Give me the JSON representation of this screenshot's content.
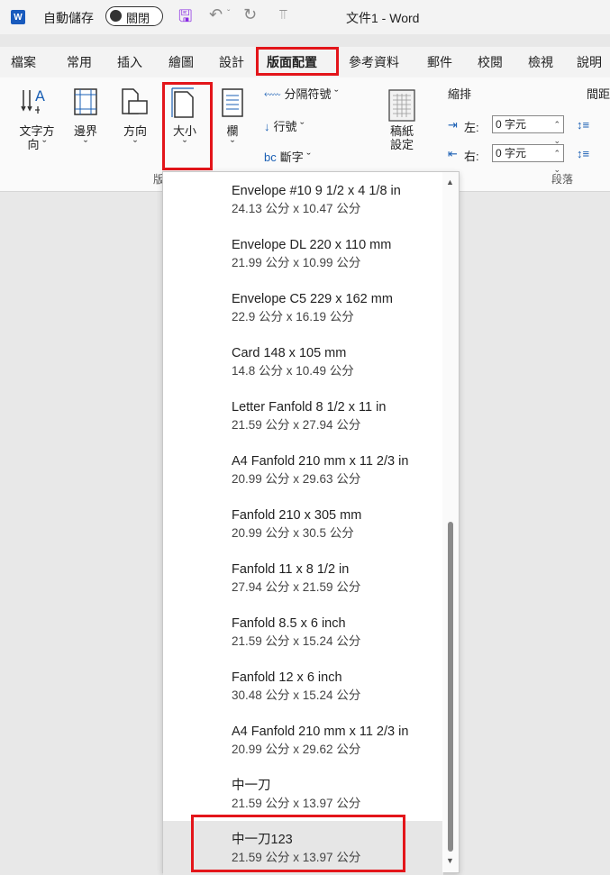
{
  "titlebar": {
    "app_icon": "W",
    "autosave_label": "自動儲存",
    "autosave_state": "關閉",
    "doc_title": "文件1 - Word",
    "icons": [
      "save-icon",
      "undo-icon",
      "redo-icon",
      "customize-qat-icon"
    ]
  },
  "tabs": [
    "檔案",
    "常用",
    "插入",
    "繪圖",
    "設計",
    "版面配置",
    "參考資料",
    "郵件",
    "校閱",
    "檢視",
    "說明"
  ],
  "active_tab": "版面配置",
  "ribbon": {
    "text_direction": {
      "line1": "文字方",
      "line2": "向 ˇ"
    },
    "margins": {
      "line1": "邊界",
      "line2": "ˇ"
    },
    "orientation": {
      "line1": "方向",
      "line2": "ˇ"
    },
    "size": {
      "line1": "大小",
      "line2": "ˇ"
    },
    "columns": {
      "line1": "欄",
      "line2": "ˇ"
    },
    "breaks": "分隔符號 ˇ",
    "line_numbers": "行號 ˇ",
    "hyphenation": "斷字 ˇ",
    "draft_settings": {
      "line1": "稿紙",
      "line2": "設定"
    },
    "indent_label": "縮排",
    "spacing_label": "間距",
    "left_label": "左:",
    "left_value": "0 字元",
    "right_label": "右:",
    "right_value": "0 字元",
    "group_page_setup": "版",
    "group_paragraph": "段落"
  },
  "size_menu": {
    "items": [
      {
        "name": "Envelope #10 9 1/2 x 4 1/8 in",
        "dims": "24.13 公分 x 10.47 公分"
      },
      {
        "name": "Envelope DL 220 x 110 mm",
        "dims": "21.99 公分 x 10.99 公分"
      },
      {
        "name": "Envelope C5 229 x 162 mm",
        "dims": "22.9 公分 x 16.19 公分"
      },
      {
        "name": "Card 148 x 105 mm",
        "dims": "14.8 公分 x 10.49 公分"
      },
      {
        "name": "Letter Fanfold 8 1/2 x 11 in",
        "dims": "21.59 公分 x 27.94 公分"
      },
      {
        "name": "A4 Fanfold 210 mm x 11 2/3 in",
        "dims": "20.99 公分 x 29.63 公分"
      },
      {
        "name": "Fanfold 210 x 305 mm",
        "dims": "20.99 公分 x 30.5 公分"
      },
      {
        "name": "Fanfold 11 x 8 1/2 in",
        "dims": "27.94 公分 x 21.59 公分"
      },
      {
        "name": "Fanfold 8.5 x 6 inch",
        "dims": "21.59 公分 x 15.24 公分"
      },
      {
        "name": "Fanfold 12 x 6 inch",
        "dims": "30.48 公分 x 15.24 公分"
      },
      {
        "name": "A4 Fanfold 210 mm x 11 2/3 in",
        "dims": "20.99 公分 x 29.62 公分"
      },
      {
        "name": "中一刀",
        "dims": "21.59 公分 x 13.97 公分"
      },
      {
        "name": "中一刀123",
        "dims": "21.59 公分 x 13.97 公分"
      }
    ],
    "selected_item": "中一刀123"
  },
  "colors": {
    "highlight": "#e3151a",
    "word_blue": "#185abd"
  }
}
